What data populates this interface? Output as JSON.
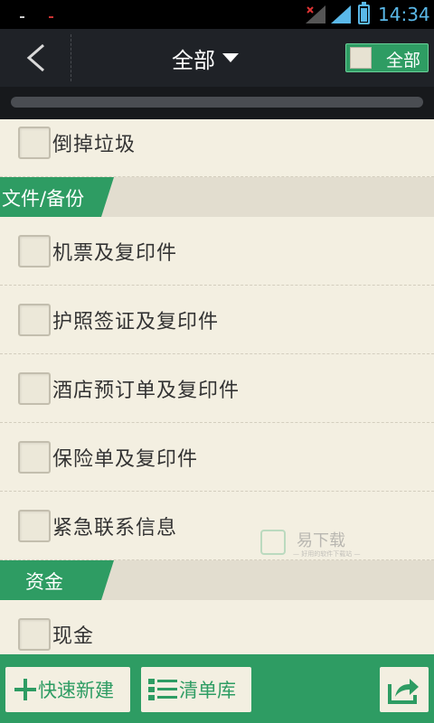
{
  "status_bar": {
    "time": "14:34"
  },
  "header": {
    "back_icon": "chevron-left-icon",
    "title": "全部",
    "select_all_label": "全部"
  },
  "progress": {
    "fraction": 0
  },
  "list": {
    "items": [
      {
        "label": "倒掉垃圾"
      },
      {
        "label": "机票及复印件"
      },
      {
        "label": "护照签证及复印件"
      },
      {
        "label": "酒店预订单及复印件"
      },
      {
        "label": "保险单及复印件"
      },
      {
        "label": "紧急联系信息"
      },
      {
        "label": "现金"
      }
    ],
    "sections": [
      {
        "title": "文件/备份"
      },
      {
        "title": "资金"
      }
    ]
  },
  "watermark": {
    "text": "易下载",
    "subtext": "— 好用的软件下载站 —"
  },
  "bottom_bar": {
    "new_label": "快速新建",
    "new_icon": "plus-icon",
    "library_label": "清单库",
    "library_icon": "list-icon",
    "share_icon": "share-icon"
  },
  "colors": {
    "accent": "#2e9c63",
    "header_bg": "#1f2227",
    "page_bg": "#f3efe1",
    "status_blue": "#5ab8e8"
  }
}
